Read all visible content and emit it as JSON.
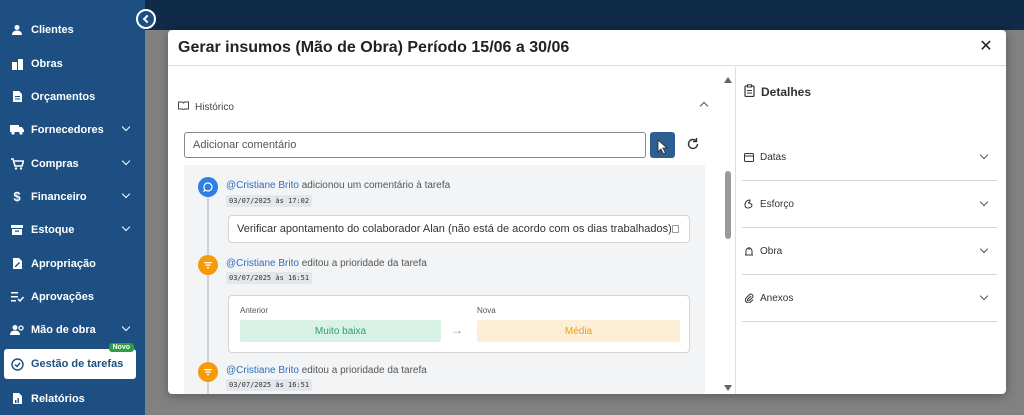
{
  "sidebar": {
    "items": [
      {
        "label": "Clientes",
        "icon": "person-icon",
        "has_chevron": false
      },
      {
        "label": "Obras",
        "icon": "buildings-icon",
        "has_chevron": false
      },
      {
        "label": "Orçamentos",
        "icon": "document-icon",
        "has_chevron": false
      },
      {
        "label": "Fornecedores",
        "icon": "truck-icon",
        "has_chevron": true
      },
      {
        "label": "Compras",
        "icon": "cart-icon",
        "has_chevron": true
      },
      {
        "label": "Financeiro",
        "icon": "dollar-icon",
        "has_chevron": true
      },
      {
        "label": "Estoque",
        "icon": "box-icon",
        "has_chevron": true
      },
      {
        "label": "Apropriação",
        "icon": "document-edit-icon",
        "has_chevron": false
      },
      {
        "label": "Aprovações",
        "icon": "checklist-icon",
        "has_chevron": false
      },
      {
        "label": "Mão de obra",
        "icon": "people-gear-icon",
        "has_chevron": true
      },
      {
        "label": "Gestão de tarefas",
        "icon": "check-circle-icon",
        "has_chevron": false,
        "active": true,
        "badge": "Novo"
      },
      {
        "label": "Relatórios",
        "icon": "report-icon",
        "has_chevron": false
      }
    ]
  },
  "modal": {
    "title": "Gerar insumos (Mão de Obra) Período 15/06 a 30/06",
    "close_icon": "close-icon"
  },
  "history": {
    "heading": "Histórico",
    "comment_placeholder": "Adicionar comentário",
    "entries": [
      {
        "user": "@Cristiane Brito",
        "action": "adicionou um comentário à tarefa",
        "date": "03/07/2025 às 17:02",
        "comment": "Verificar apontamento do colaborador Alan (não está de acordo com os dias trabalhados)"
      },
      {
        "user": "@Cristiane Brito",
        "action": "editou a prioridade da tarefa",
        "date": "03/07/2025 às 16:51",
        "before_label": "Anterior",
        "before_value": "Muito baixa",
        "after_label": "Nova",
        "after_value": "Média"
      },
      {
        "user": "@Cristiane Brito",
        "action": "editou a prioridade da tarefa",
        "date": "03/07/2025 às 16:51"
      }
    ]
  },
  "details": {
    "title": "Detalhes",
    "sections": [
      {
        "label": "Datas",
        "icon": "calendar-icon"
      },
      {
        "label": "Esforço",
        "icon": "effort-icon"
      },
      {
        "label": "Obra",
        "icon": "building-icon"
      },
      {
        "label": "Anexos",
        "icon": "paperclip-icon"
      }
    ]
  },
  "colors": {
    "sidebar": "#1d4f82",
    "primary_button": "#2e5f92",
    "comment_dot": "#2f7fe6",
    "priority_dot": "#f59a0b",
    "badge": "#2e9e3e",
    "before_bg": "#d9f2e6",
    "before_text": "#2e9e6b",
    "after_bg": "#fcefd6",
    "after_text": "#e6a11c"
  }
}
